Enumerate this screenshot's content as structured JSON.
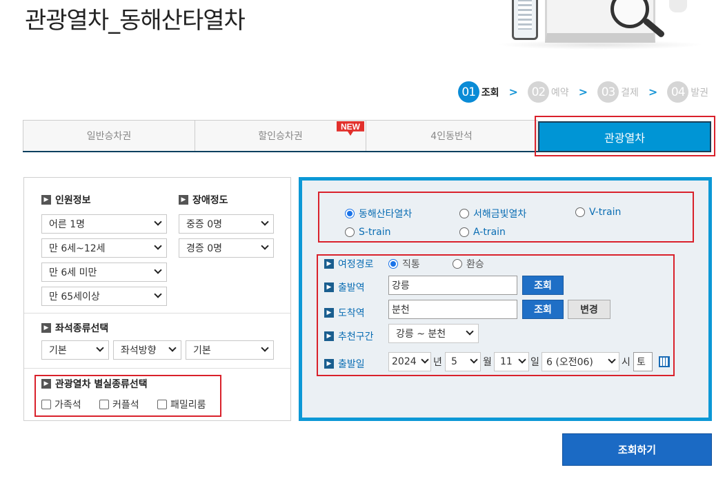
{
  "page_title": "관광열차_동해산타열차",
  "steps": [
    {
      "num": "01",
      "label": "조회"
    },
    {
      "num": "02",
      "label": "예약"
    },
    {
      "num": "03",
      "label": "결제"
    },
    {
      "num": "04",
      "label": "발권"
    }
  ],
  "tabs": [
    {
      "label": "일반승차권"
    },
    {
      "label": "할인승차권"
    },
    {
      "label": "4인동반석"
    },
    {
      "label": "관광열차"
    }
  ],
  "new_badge": "NEW",
  "passenger": {
    "heading": "인원정보",
    "adult": "어른 1명",
    "child": "만 6세~12세",
    "infant": "만 6세 미만",
    "senior": "만 65세이상"
  },
  "disability": {
    "heading": "장애정도",
    "severe": "중증 0명",
    "mild": "경증 0명"
  },
  "seat_type": {
    "heading": "좌석종류선택",
    "type": "기본",
    "direction": "좌석방향",
    "position": "기본"
  },
  "room_type": {
    "heading": "관광열차 별실종류선택",
    "options": [
      "가족석",
      "커플석",
      "패밀리룸"
    ]
  },
  "trains": [
    "동해산타열차",
    "서해금빛열차",
    "V-train",
    "S-train",
    "A-train"
  ],
  "route": {
    "label": "여정경로",
    "options": [
      "직통",
      "환승"
    ]
  },
  "departure": {
    "label": "출발역",
    "value": "강릉",
    "button": "조회"
  },
  "arrival": {
    "label": "도착역",
    "value": "분천",
    "button": "조회",
    "swap": "변경"
  },
  "section": {
    "label": "추천구간",
    "value": "강릉 ~ 분천"
  },
  "date": {
    "label": "출발일",
    "year": "2024",
    "year_unit": "년",
    "month": "5",
    "month_unit": "월",
    "day": "11",
    "day_unit": "일",
    "hour": "6 (오전06)",
    "hour_unit": "시",
    "weekday": "토"
  },
  "search_button": "조회하기"
}
